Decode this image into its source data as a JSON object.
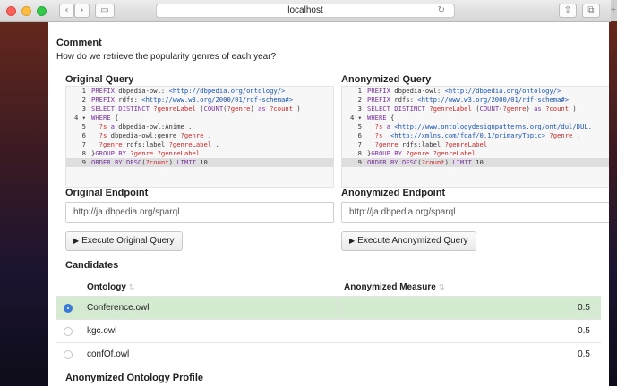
{
  "browser": {
    "url": "localhost",
    "icons": [
      "back-icon",
      "forward-icon",
      "sidebar-icon",
      "reload-icon",
      "share-icon",
      "tabs-icon",
      "new-tab-icon"
    ]
  },
  "comment": {
    "heading": "Comment",
    "text": "How do we retrieve the popularity genres of each year?"
  },
  "original_query": {
    "title": "Original Query",
    "lines": [
      {
        "n": "1",
        "tokens": [
          [
            "kw",
            "PREFIX "
          ],
          [
            "tx",
            "dbpedia-owl: "
          ],
          [
            "ur",
            "<http://dbpedia.org/ontology/>"
          ]
        ]
      },
      {
        "n": "2",
        "tokens": [
          [
            "kw",
            "PREFIX "
          ],
          [
            "tx",
            "rdfs: "
          ],
          [
            "ur",
            "<http://www.w3.org/2000/01/rdf-schema#>"
          ]
        ]
      },
      {
        "n": "3",
        "tokens": [
          [
            "kw",
            "SELECT DISTINCT "
          ],
          [
            "vr",
            "?genreLabel "
          ],
          [
            "tx",
            "("
          ],
          [
            "kw",
            "COUNT"
          ],
          [
            "tx",
            "("
          ],
          [
            "vr",
            "?genre"
          ],
          [
            "tx",
            ") "
          ],
          [
            "kw",
            "as "
          ],
          [
            "vr",
            "?count"
          ],
          [
            "tx",
            " )"
          ]
        ]
      },
      {
        "n": "4 ▾",
        "tokens": [
          [
            "kw",
            "WHERE "
          ],
          [
            "tx",
            "{"
          ]
        ]
      },
      {
        "n": "5",
        "tokens": [
          [
            "tx",
            "  "
          ],
          [
            "vr",
            "?s "
          ],
          [
            "kw",
            "a "
          ],
          [
            "tx",
            "dbpedia-owl:Anime ."
          ]
        ]
      },
      {
        "n": "6",
        "tokens": [
          [
            "tx",
            "  "
          ],
          [
            "vr",
            "?s "
          ],
          [
            "tx",
            "dbpedia-owl:genre "
          ],
          [
            "vr",
            "?genre"
          ],
          [
            "tx",
            " ."
          ]
        ]
      },
      {
        "n": "7",
        "tokens": [
          [
            "tx",
            "  "
          ],
          [
            "vr",
            "?genre "
          ],
          [
            "tx",
            "rdfs:label "
          ],
          [
            "vr",
            "?genreLabel"
          ],
          [
            "tx",
            " ."
          ]
        ]
      },
      {
        "n": "8",
        "tokens": [
          [
            "tx",
            "}"
          ],
          [
            "kw",
            "GROUP BY "
          ],
          [
            "vr",
            "?genre ?genreLabel"
          ]
        ]
      },
      {
        "n": "9",
        "tokens": [
          [
            "kw",
            "ORDER BY "
          ],
          [
            "kw",
            "DESC"
          ],
          [
            "tx",
            "("
          ],
          [
            "vr",
            "?count"
          ],
          [
            "tx",
            ") "
          ],
          [
            "kw",
            "LIMIT "
          ],
          [
            "tx",
            "10"
          ]
        ]
      }
    ]
  },
  "anonymized_query": {
    "title": "Anonymized Query",
    "lines": [
      {
        "n": "1",
        "tokens": [
          [
            "kw",
            "PREFIX "
          ],
          [
            "tx",
            "dbpedia-owl: "
          ],
          [
            "ur",
            "<http://dbpedia.org/ontology/>"
          ]
        ]
      },
      {
        "n": "2",
        "tokens": [
          [
            "kw",
            "PREFIX "
          ],
          [
            "tx",
            "rdfs: "
          ],
          [
            "ur",
            "<http://www.w3.org/2000/01/rdf-schema#>"
          ]
        ]
      },
      {
        "n": "3",
        "tokens": [
          [
            "kw",
            "SELECT DISTINCT "
          ],
          [
            "vr",
            "?genreLabel "
          ],
          [
            "tx",
            "("
          ],
          [
            "kw",
            "COUNT"
          ],
          [
            "tx",
            "("
          ],
          [
            "vr",
            "?genre"
          ],
          [
            "tx",
            ") "
          ],
          [
            "kw",
            "as "
          ],
          [
            "vr",
            "?count"
          ],
          [
            "tx",
            " )"
          ]
        ]
      },
      {
        "n": "4 ▾",
        "tokens": [
          [
            "kw",
            "WHERE "
          ],
          [
            "tx",
            "{"
          ]
        ]
      },
      {
        "n": "5",
        "tokens": [
          [
            "tx",
            "  "
          ],
          [
            "vr",
            "?s "
          ],
          [
            "kw",
            "a "
          ],
          [
            "ur",
            "<http://www.ontologydesignpatterns.org/ont/dul/DUL."
          ]
        ]
      },
      {
        "n": "6",
        "tokens": [
          [
            "tx",
            "  "
          ],
          [
            "vr",
            "?s "
          ],
          [
            "ur",
            " <http://xmlns.com/foaf/0.1/primaryTopic> "
          ],
          [
            "vr",
            "?genre"
          ],
          [
            "tx",
            " ."
          ]
        ]
      },
      {
        "n": "7",
        "tokens": [
          [
            "tx",
            "  "
          ],
          [
            "vr",
            "?genre "
          ],
          [
            "tx",
            "rdfs:label "
          ],
          [
            "vr",
            "?genreLabel"
          ],
          [
            "tx",
            " ."
          ]
        ]
      },
      {
        "n": "8",
        "tokens": [
          [
            "tx",
            "}"
          ],
          [
            "kw",
            "GROUP BY "
          ],
          [
            "vr",
            "?genre ?genreLabel"
          ]
        ]
      },
      {
        "n": "9",
        "tokens": [
          [
            "kw",
            "ORDER BY "
          ],
          [
            "kw",
            "DESC"
          ],
          [
            "tx",
            "("
          ],
          [
            "vr",
            "?count"
          ],
          [
            "tx",
            ") "
          ],
          [
            "kw",
            "LIMIT "
          ],
          [
            "tx",
            "10"
          ]
        ]
      }
    ]
  },
  "original_endpoint": {
    "title": "Original Endpoint",
    "value": "http://ja.dbpedia.org/sparql"
  },
  "anonymized_endpoint": {
    "title": "Anonymized Endpoint",
    "value": "http://ja.dbpedia.org/sparql"
  },
  "buttons": {
    "execute_original": "Execute Original Query",
    "execute_anonymized": "Execute Anonymized Query",
    "play_glyph": "▶"
  },
  "candidates": {
    "title": "Candidates",
    "col_ontology": "Ontology",
    "col_measure": "Anonymized Measure",
    "sort_glyph": "⇅",
    "rows": [
      {
        "name": "Conference.owl",
        "value": "0.5",
        "selected": true
      },
      {
        "name": "kgc.owl",
        "value": "0.5",
        "selected": false
      },
      {
        "name": "confOf.owl",
        "value": "0.5",
        "selected": false
      }
    ]
  },
  "profile_title": "Anonymized Ontology Profile",
  "colors": {
    "selected_row": "#d5ebd1",
    "radio_on": "#3b7ad6",
    "keyword": "#7a33a0",
    "variable": "#c22a2a",
    "uri": "#1a55b0"
  }
}
